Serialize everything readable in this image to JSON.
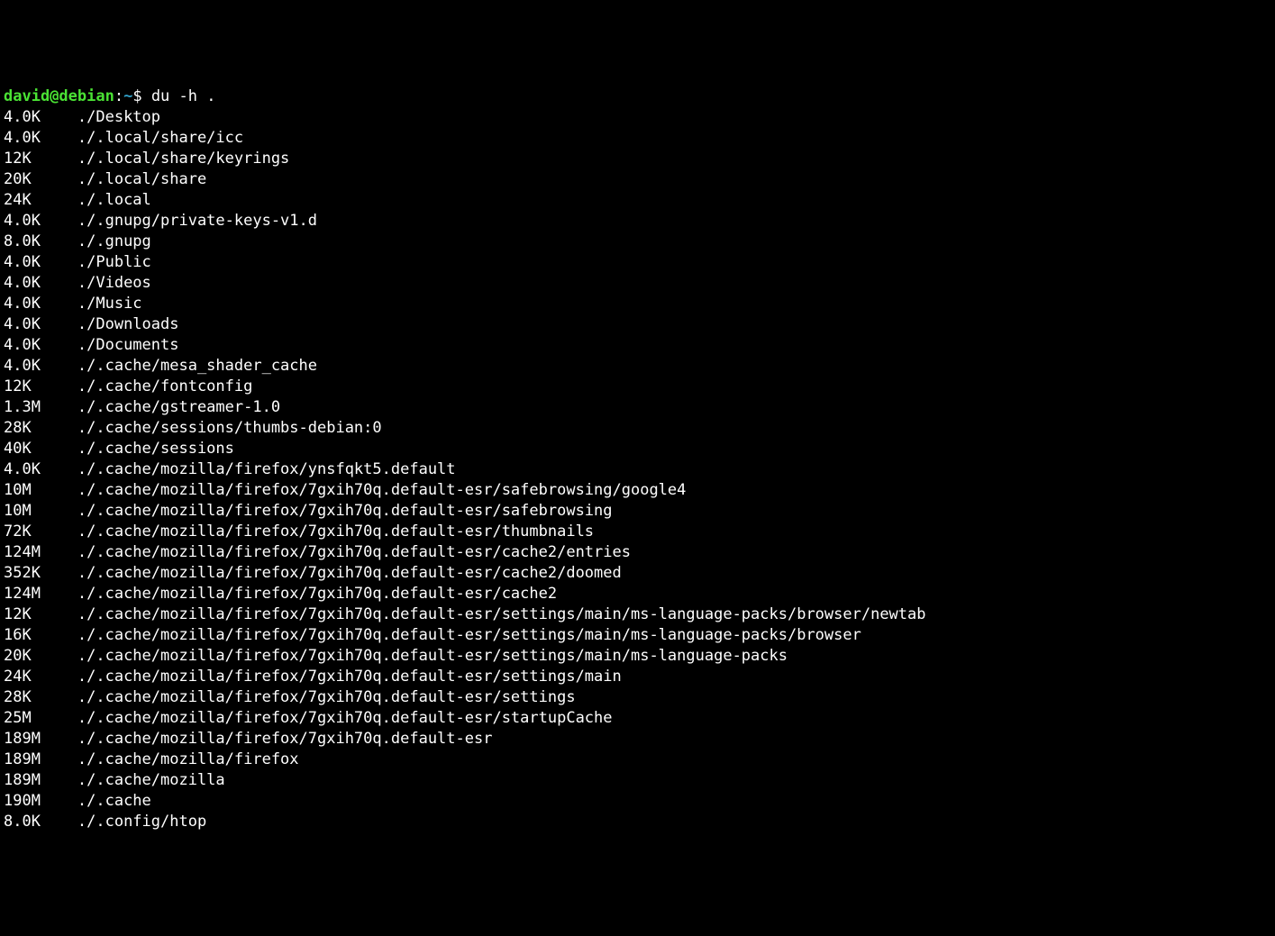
{
  "prompt": {
    "user": "david@debian",
    "sep": ":",
    "cwd": "~",
    "end": "$ ",
    "command": "du -h ."
  },
  "rows": [
    {
      "size": "4.0K",
      "path": "./Desktop"
    },
    {
      "size": "4.0K",
      "path": "./.local/share/icc"
    },
    {
      "size": "12K",
      "path": "./.local/share/keyrings"
    },
    {
      "size": "20K",
      "path": "./.local/share"
    },
    {
      "size": "24K",
      "path": "./.local"
    },
    {
      "size": "4.0K",
      "path": "./.gnupg/private-keys-v1.d"
    },
    {
      "size": "8.0K",
      "path": "./.gnupg"
    },
    {
      "size": "4.0K",
      "path": "./Public"
    },
    {
      "size": "4.0K",
      "path": "./Videos"
    },
    {
      "size": "4.0K",
      "path": "./Music"
    },
    {
      "size": "4.0K",
      "path": "./Downloads"
    },
    {
      "size": "4.0K",
      "path": "./Documents"
    },
    {
      "size": "4.0K",
      "path": "./.cache/mesa_shader_cache"
    },
    {
      "size": "12K",
      "path": "./.cache/fontconfig"
    },
    {
      "size": "1.3M",
      "path": "./.cache/gstreamer-1.0"
    },
    {
      "size": "28K",
      "path": "./.cache/sessions/thumbs-debian:0"
    },
    {
      "size": "40K",
      "path": "./.cache/sessions"
    },
    {
      "size": "4.0K",
      "path": "./.cache/mozilla/firefox/ynsfqkt5.default"
    },
    {
      "size": "10M",
      "path": "./.cache/mozilla/firefox/7gxih70q.default-esr/safebrowsing/google4"
    },
    {
      "size": "10M",
      "path": "./.cache/mozilla/firefox/7gxih70q.default-esr/safebrowsing"
    },
    {
      "size": "72K",
      "path": "./.cache/mozilla/firefox/7gxih70q.default-esr/thumbnails"
    },
    {
      "size": "124M",
      "path": "./.cache/mozilla/firefox/7gxih70q.default-esr/cache2/entries"
    },
    {
      "size": "352K",
      "path": "./.cache/mozilla/firefox/7gxih70q.default-esr/cache2/doomed"
    },
    {
      "size": "124M",
      "path": "./.cache/mozilla/firefox/7gxih70q.default-esr/cache2"
    },
    {
      "size": "12K",
      "path": "./.cache/mozilla/firefox/7gxih70q.default-esr/settings/main/ms-language-packs/browser/newtab"
    },
    {
      "size": "16K",
      "path": "./.cache/mozilla/firefox/7gxih70q.default-esr/settings/main/ms-language-packs/browser"
    },
    {
      "size": "20K",
      "path": "./.cache/mozilla/firefox/7gxih70q.default-esr/settings/main/ms-language-packs"
    },
    {
      "size": "24K",
      "path": "./.cache/mozilla/firefox/7gxih70q.default-esr/settings/main"
    },
    {
      "size": "28K",
      "path": "./.cache/mozilla/firefox/7gxih70q.default-esr/settings"
    },
    {
      "size": "25M",
      "path": "./.cache/mozilla/firefox/7gxih70q.default-esr/startupCache"
    },
    {
      "size": "189M",
      "path": "./.cache/mozilla/firefox/7gxih70q.default-esr"
    },
    {
      "size": "189M",
      "path": "./.cache/mozilla/firefox"
    },
    {
      "size": "189M",
      "path": "./.cache/mozilla"
    },
    {
      "size": "190M",
      "path": "./.cache"
    },
    {
      "size": "8.0K",
      "path": "./.config/htop"
    }
  ]
}
